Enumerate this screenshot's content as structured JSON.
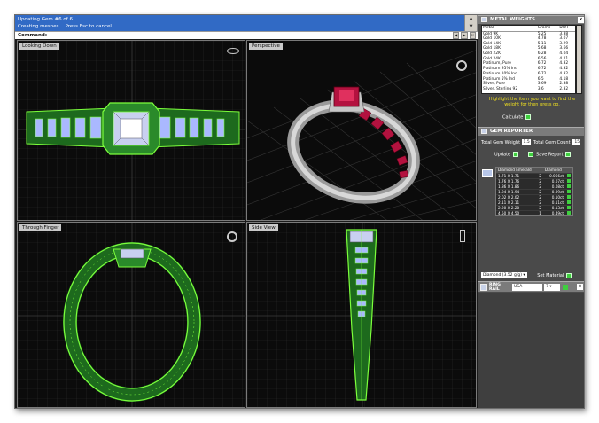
{
  "command": {
    "history": [
      "Updating Gem #6 of 6",
      "Creating meshes... Press Esc to cancel."
    ],
    "prompt": "Command:",
    "toolbar": [
      "◀",
      "▶",
      "✕"
    ]
  },
  "viewports": {
    "top_left": "Looking Down",
    "top_right": "Perspective",
    "bottom_left": "Through Finger",
    "bottom_right": "Side View"
  },
  "metal_weights": {
    "title": "METAL WEIGHTS",
    "columns": [
      "Metal",
      "Grams",
      "DWT"
    ],
    "rows": [
      [
        "Gold 9K",
        "5.25",
        "3.38"
      ],
      [
        "Gold 10K",
        "4.78",
        "3.07"
      ],
      [
        "Gold 14K",
        "5.11",
        "3.29"
      ],
      [
        "Gold 18K",
        "5.68",
        "3.66"
      ],
      [
        "Gold 22K",
        "6.28",
        "4.04"
      ],
      [
        "Gold 24K",
        "6.56",
        "4.21"
      ],
      [
        "Platinum, Pure",
        "6.72",
        "4.32"
      ],
      [
        "Platinum 95% Ind",
        "6.72",
        "4.32"
      ],
      [
        "Platinum 10% Ind",
        "6.72",
        "4.32"
      ],
      [
        "Platinum 5% Ind",
        "6.5",
        "4.18"
      ],
      [
        "Silver, Pure",
        "3.69",
        "2.38"
      ],
      [
        "Silver, Sterling 92",
        "3.6",
        "2.32"
      ]
    ],
    "hint": "Highlight the item you want to find the weight for then press go.",
    "calculate_label": "Calculate"
  },
  "gem_reporter": {
    "title": "GEM REPORTER",
    "total_weight_label": "Total Gem Weight",
    "total_weight_value": "1.5",
    "total_count_label": "Total Gem Count",
    "total_count_value": "15",
    "update_label": "Update",
    "save_report_label": "Save Report",
    "columns": [
      "Diamond Emerald",
      "",
      "Diamond"
    ],
    "rows": [
      [
        "1.71 X 1.71",
        "2",
        "0.066ct"
      ],
      [
        "1.76 X 1.76",
        "2",
        "0.07ct"
      ],
      [
        "1.86 X 1.86",
        "2",
        "0.08ct"
      ],
      [
        "1.94 X 1.94",
        "2",
        "0.09ct"
      ],
      [
        "2.02 X 2.02",
        "2",
        "0.10ct"
      ],
      [
        "2.11 X 2.11",
        "2",
        "0.11ct"
      ],
      [
        "2.20 X 2.20",
        "2",
        "0.13ct"
      ],
      [
        "4.50 X 4.50",
        "1",
        "0.49ct"
      ]
    ],
    "material_select": "Diamond",
    "material_density": "(3.52 g/g)",
    "set_material_label": "Set Material"
  },
  "ring_rail": {
    "title": "RING RAIL",
    "country": "USA",
    "size": "7"
  },
  "colors": {
    "wire_green": "#7cff3c",
    "ruby": "#b3123f",
    "panel_bg": "#4a4a4a"
  }
}
